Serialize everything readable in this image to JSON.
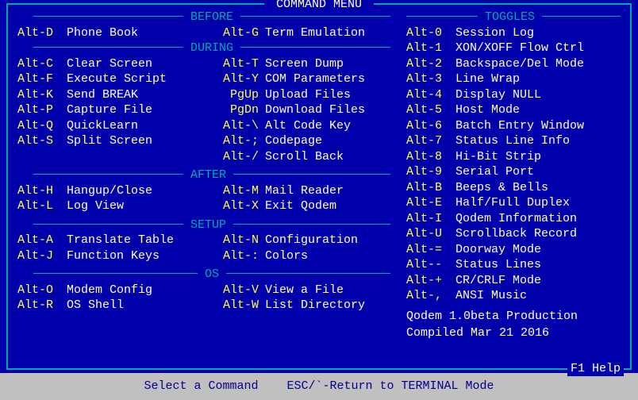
{
  "window": {
    "title": " COMMAND MENU ",
    "f1help": "F1 Help"
  },
  "statusbar": "Select a Command    ESC/`-Return to TERMINAL Mode",
  "left": {
    "before": {
      "title": " BEFORE ",
      "items": [
        {
          "k1": "Alt-D",
          "d1": "Phone Book",
          "k2": "Alt-G",
          "d2": "Term Emulation"
        }
      ]
    },
    "during": {
      "title": " DURING ",
      "items": [
        {
          "k1": "Alt-C",
          "d1": "Clear Screen",
          "k2": "Alt-T",
          "d2": "Screen Dump"
        },
        {
          "k1": "Alt-F",
          "d1": "Execute Script",
          "k2": "Alt-Y",
          "d2": "COM Parameters"
        },
        {
          "k1": "Alt-K",
          "d1": "Send BREAK",
          "k2": "PgUp",
          "d2": "Upload Files"
        },
        {
          "k1": "Alt-P",
          "d1": "Capture File",
          "k2": "PgDn",
          "d2": "Download Files"
        },
        {
          "k1": "Alt-Q",
          "d1": "QuickLearn",
          "k2": "Alt-\\",
          "d2": "Alt Code Key"
        },
        {
          "k1": "Alt-S",
          "d1": "Split Screen",
          "k2": "Alt-;",
          "d2": "Codepage"
        },
        {
          "k1": "",
          "d1": "",
          "k2": "Alt-/",
          "d2": "Scroll Back"
        }
      ]
    },
    "after": {
      "title": " AFTER ",
      "items": [
        {
          "k1": "Alt-H",
          "d1": "Hangup/Close",
          "k2": "Alt-M",
          "d2": "Mail Reader"
        },
        {
          "k1": "Alt-L",
          "d1": "Log View",
          "k2": "Alt-X",
          "d2": "Exit Qodem"
        }
      ]
    },
    "setup": {
      "title": " SETUP ",
      "items": [
        {
          "k1": "Alt-A",
          "d1": "Translate Table",
          "k2": "Alt-N",
          "d2": "Configuration"
        },
        {
          "k1": "Alt-J",
          "d1": "Function Keys",
          "k2": "Alt-:",
          "d2": "Colors"
        }
      ]
    },
    "os": {
      "title": " OS ",
      "items": [
        {
          "k1": "Alt-O",
          "d1": "Modem Config",
          "k2": "Alt-V",
          "d2": "View a File"
        },
        {
          "k1": "Alt-R",
          "d1": "OS Shell",
          "k2": "Alt-W",
          "d2": "List Directory"
        }
      ]
    }
  },
  "right": {
    "toggles": {
      "title": " TOGGLES ",
      "items": [
        {
          "k": "Alt-0",
          "d": "Session Log"
        },
        {
          "k": "Alt-1",
          "d": "XON/XOFF Flow Ctrl"
        },
        {
          "k": "Alt-2",
          "d": "Backspace/Del Mode"
        },
        {
          "k": "Alt-3",
          "d": "Line Wrap"
        },
        {
          "k": "Alt-4",
          "d": "Display NULL"
        },
        {
          "k": "Alt-5",
          "d": "Host Mode"
        },
        {
          "k": "Alt-6",
          "d": "Batch Entry Window"
        },
        {
          "k": "Alt-7",
          "d": "Status Line Info"
        },
        {
          "k": "Alt-8",
          "d": "Hi-Bit Strip"
        },
        {
          "k": "Alt-9",
          "d": "Serial Port"
        },
        {
          "k": "Alt-B",
          "d": "Beeps & Bells"
        },
        {
          "k": "Alt-E",
          "d": "Half/Full Duplex"
        },
        {
          "k": "Alt-I",
          "d": "Qodem Information"
        },
        {
          "k": "Alt-U",
          "d": "Scrollback Record"
        },
        {
          "k": "Alt-=",
          "d": "Doorway Mode"
        },
        {
          "k": "Alt--",
          "d": "Status Lines"
        },
        {
          "k": "Alt-+",
          "d": "CR/CRLF Mode"
        },
        {
          "k": "Alt-,",
          "d": "ANSI Music"
        }
      ]
    },
    "version": {
      "line1": "Qodem 1.0beta Production",
      "line2": "Compiled Mar 21 2016"
    }
  }
}
